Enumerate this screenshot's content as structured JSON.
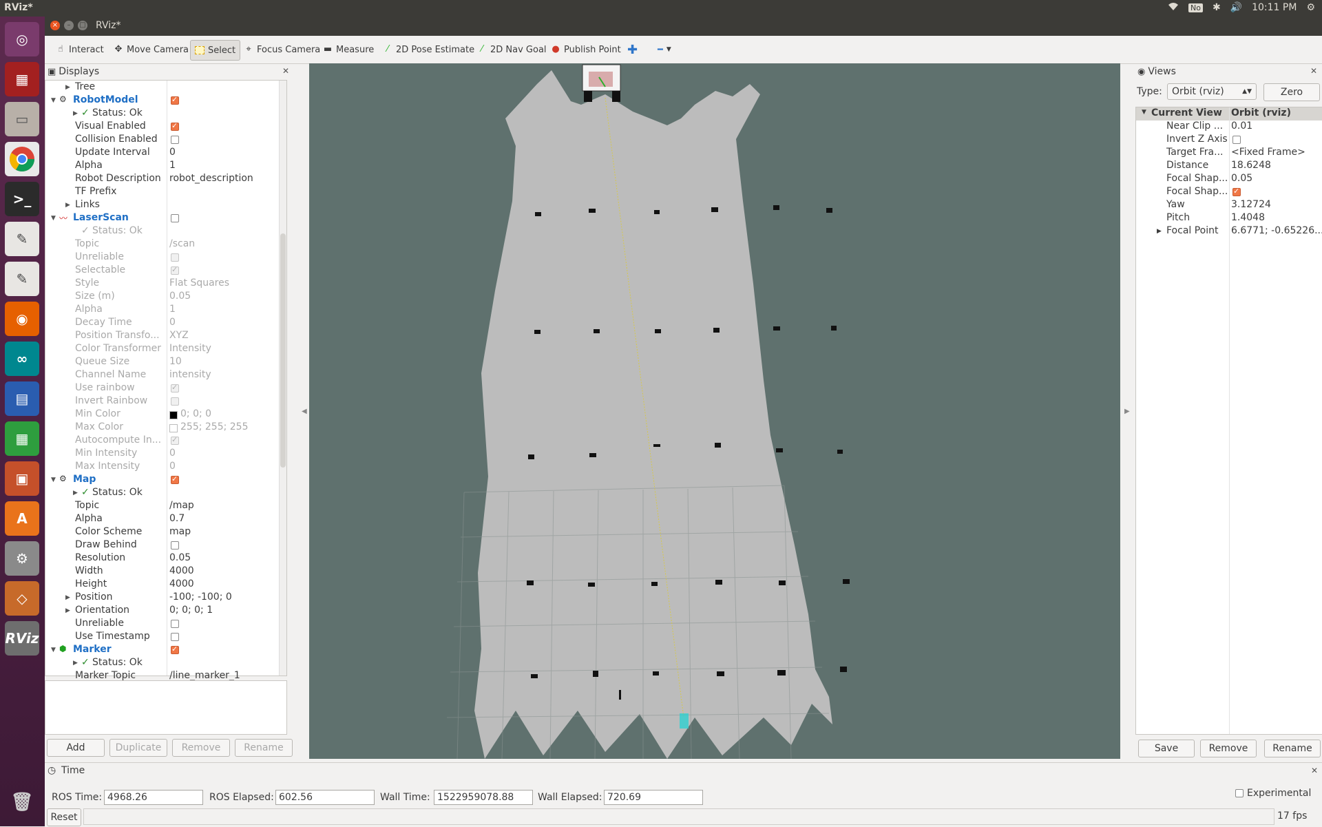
{
  "topbar": {
    "app_title": "RViz*",
    "keyboard": "No",
    "clock": "10:11 PM"
  },
  "window": {
    "title": "RViz*"
  },
  "toolbar": {
    "interact": "Interact",
    "move_camera": "Move Camera",
    "select": "Select",
    "focus_camera": "Focus Camera",
    "measure": "Measure",
    "pose_estimate": "2D Pose Estimate",
    "nav_goal": "2D Nav Goal",
    "publish_point": "Publish Point"
  },
  "displays": {
    "title": "Displays",
    "rows": [
      {
        "name": "Tree",
        "value": "",
        "indent": 1,
        "arrow": "right"
      },
      {
        "name": "RobotModel",
        "value": "",
        "indent": 0,
        "arrow": "down",
        "header": true,
        "check": true
      },
      {
        "name": "Status: Ok",
        "value": "",
        "indent": 2,
        "arrow": "right",
        "status": true
      },
      {
        "name": "Visual Enabled",
        "value": "",
        "indent": 1,
        "check": true
      },
      {
        "name": "Collision Enabled",
        "value": "",
        "indent": 1,
        "check": false
      },
      {
        "name": "Update Interval",
        "value": "0",
        "indent": 1
      },
      {
        "name": "Alpha",
        "value": "1",
        "indent": 1
      },
      {
        "name": "Robot Description",
        "value": "robot_description",
        "indent": 1
      },
      {
        "name": "TF Prefix",
        "value": "",
        "indent": 1
      },
      {
        "name": "Links",
        "value": "",
        "indent": 1,
        "arrow": "right"
      },
      {
        "name": "LaserScan",
        "value": "",
        "indent": 0,
        "arrow": "down",
        "header": true,
        "check": false
      },
      {
        "name": "Status: Ok",
        "value": "",
        "indent": 2,
        "status": true,
        "disabled": true
      },
      {
        "name": "Topic",
        "value": "/scan",
        "indent": 1,
        "disabled": true
      },
      {
        "name": "Unreliable",
        "value": "",
        "indent": 1,
        "disabled": true,
        "check": false
      },
      {
        "name": "Selectable",
        "value": "",
        "indent": 1,
        "disabled": true,
        "check": true
      },
      {
        "name": "Style",
        "value": "Flat Squares",
        "indent": 1,
        "disabled": true
      },
      {
        "name": "Size (m)",
        "value": "0.05",
        "indent": 1,
        "disabled": true
      },
      {
        "name": "Alpha",
        "value": "1",
        "indent": 1,
        "disabled": true
      },
      {
        "name": "Decay Time",
        "value": "0",
        "indent": 1,
        "disabled": true
      },
      {
        "name": "Position Transfo...",
        "value": "XYZ",
        "indent": 1,
        "disabled": true
      },
      {
        "name": "Color Transformer",
        "value": "Intensity",
        "indent": 1,
        "disabled": true
      },
      {
        "name": "Queue Size",
        "value": "10",
        "indent": 1,
        "disabled": true
      },
      {
        "name": "Channel Name",
        "value": "intensity",
        "indent": 1,
        "disabled": true
      },
      {
        "name": "Use rainbow",
        "value": "",
        "indent": 1,
        "disabled": true,
        "check": true
      },
      {
        "name": "Invert Rainbow",
        "value": "",
        "indent": 1,
        "disabled": true,
        "check": false
      },
      {
        "name": "Min Color",
        "value": "0; 0; 0",
        "indent": 1,
        "disabled": true,
        "swatch": "#000000"
      },
      {
        "name": "Max Color",
        "value": "255; 255; 255",
        "indent": 1,
        "disabled": true,
        "swatch": "#ffffff"
      },
      {
        "name": "Autocompute In...",
        "value": "",
        "indent": 1,
        "disabled": true,
        "check": true
      },
      {
        "name": "Min Intensity",
        "value": "0",
        "indent": 1,
        "disabled": true
      },
      {
        "name": "Max Intensity",
        "value": "0",
        "indent": 1,
        "disabled": true
      },
      {
        "name": "Map",
        "value": "",
        "indent": 0,
        "arrow": "down",
        "header": true,
        "check": true
      },
      {
        "name": "Status: Ok",
        "value": "",
        "indent": 2,
        "arrow": "right",
        "status": true
      },
      {
        "name": "Topic",
        "value": "/map",
        "indent": 1
      },
      {
        "name": "Alpha",
        "value": "0.7",
        "indent": 1
      },
      {
        "name": "Color Scheme",
        "value": "map",
        "indent": 1
      },
      {
        "name": "Draw Behind",
        "value": "",
        "indent": 1,
        "check": false
      },
      {
        "name": "Resolution",
        "value": "0.05",
        "indent": 1
      },
      {
        "name": "Width",
        "value": "4000",
        "indent": 1
      },
      {
        "name": "Height",
        "value": "4000",
        "indent": 1
      },
      {
        "name": "Position",
        "value": "-100; -100; 0",
        "indent": 1,
        "arrow": "right"
      },
      {
        "name": "Orientation",
        "value": "0; 0; 0; 1",
        "indent": 1,
        "arrow": "right"
      },
      {
        "name": "Unreliable",
        "value": "",
        "indent": 1,
        "check": false
      },
      {
        "name": "Use Timestamp",
        "value": "",
        "indent": 1,
        "check": false
      },
      {
        "name": "Marker",
        "value": "",
        "indent": 0,
        "arrow": "down",
        "header": true,
        "check": true
      },
      {
        "name": "Status: Ok",
        "value": "",
        "indent": 2,
        "arrow": "right",
        "status": true
      },
      {
        "name": "Marker Topic",
        "value": "/line_marker_1",
        "indent": 1
      }
    ],
    "buttons": {
      "add": "Add",
      "duplicate": "Duplicate",
      "remove": "Remove",
      "rename": "Rename"
    }
  },
  "views": {
    "title": "Views",
    "type_label": "Type:",
    "type_value": "Orbit (rviz)",
    "zero": "Zero",
    "header_name": "Current View",
    "header_value": "Orbit (rviz)",
    "rows": [
      {
        "name": "Near Clip ...",
        "value": "0.01"
      },
      {
        "name": "Invert Z Axis",
        "value": "",
        "check": false
      },
      {
        "name": "Target Fra...",
        "value": "<Fixed Frame>"
      },
      {
        "name": "Distance",
        "value": "18.6248"
      },
      {
        "name": "Focal Shap...",
        "value": "0.05"
      },
      {
        "name": "Focal Shap...",
        "value": "",
        "check": true
      },
      {
        "name": "Yaw",
        "value": "3.12724"
      },
      {
        "name": "Pitch",
        "value": "1.4048"
      },
      {
        "name": "Focal Point",
        "value": "6.6771; -0.65226...",
        "arrow": "right"
      }
    ],
    "buttons": {
      "save": "Save",
      "remove": "Remove",
      "rename": "Rename"
    }
  },
  "time": {
    "title": "Time",
    "ros_time_label": "ROS Time:",
    "ros_time": "4968.26",
    "ros_elapsed_label": "ROS Elapsed:",
    "ros_elapsed": "602.56",
    "wall_time_label": "Wall Time:",
    "wall_time": "1522959078.88",
    "wall_elapsed_label": "Wall Elapsed:",
    "wall_elapsed": "720.69",
    "experimental": "Experimental",
    "reset": "Reset",
    "fps": "17 fps"
  },
  "colors": {
    "map_free": "#bcbcbc",
    "background": "#5f716e",
    "accent": "#f07746",
    "header_blue": "#1f6fc5"
  }
}
